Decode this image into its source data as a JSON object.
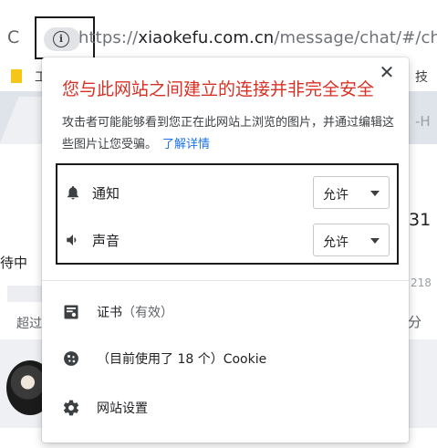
{
  "toolbar": {
    "url_scheme": "https://",
    "url_host": "xiaokefu.com.cn",
    "url_path": "/message/chat/#/chat"
  },
  "background": {
    "bookmark_fragment": "工",
    "bookmark_right_fragment": "技",
    "tab_right_fragment": "-H",
    "number_31": "31",
    "waiting_fragment": "待中",
    "count_218": "218",
    "chao_fragment": "超过",
    "fen_fragment": "分"
  },
  "popup": {
    "title": "您与此网站之间建立的连接并非完全安全",
    "description": "攻击者可能能够看到您正在此网站上浏览的图片，并通过编辑这些图片让您受骗。",
    "learn_more": "了解详情",
    "permissions": [
      {
        "label": "通知",
        "icon": "bell-icon",
        "value": "允许"
      },
      {
        "label": "声音",
        "icon": "speaker-icon",
        "value": "允许"
      }
    ],
    "menu": [
      {
        "label": "证书",
        "sublabel": "（有效）",
        "icon": "certificate-icon"
      },
      {
        "label": "（目前使用了 18 个）Cookie",
        "icon": "cookie-icon"
      },
      {
        "label": "网站设置",
        "icon": "settings-gear-icon"
      }
    ]
  },
  "colors": {
    "warning_red": "#d93025",
    "link_blue": "#1a73e8",
    "bookmark_yellow": "#f5c518"
  }
}
